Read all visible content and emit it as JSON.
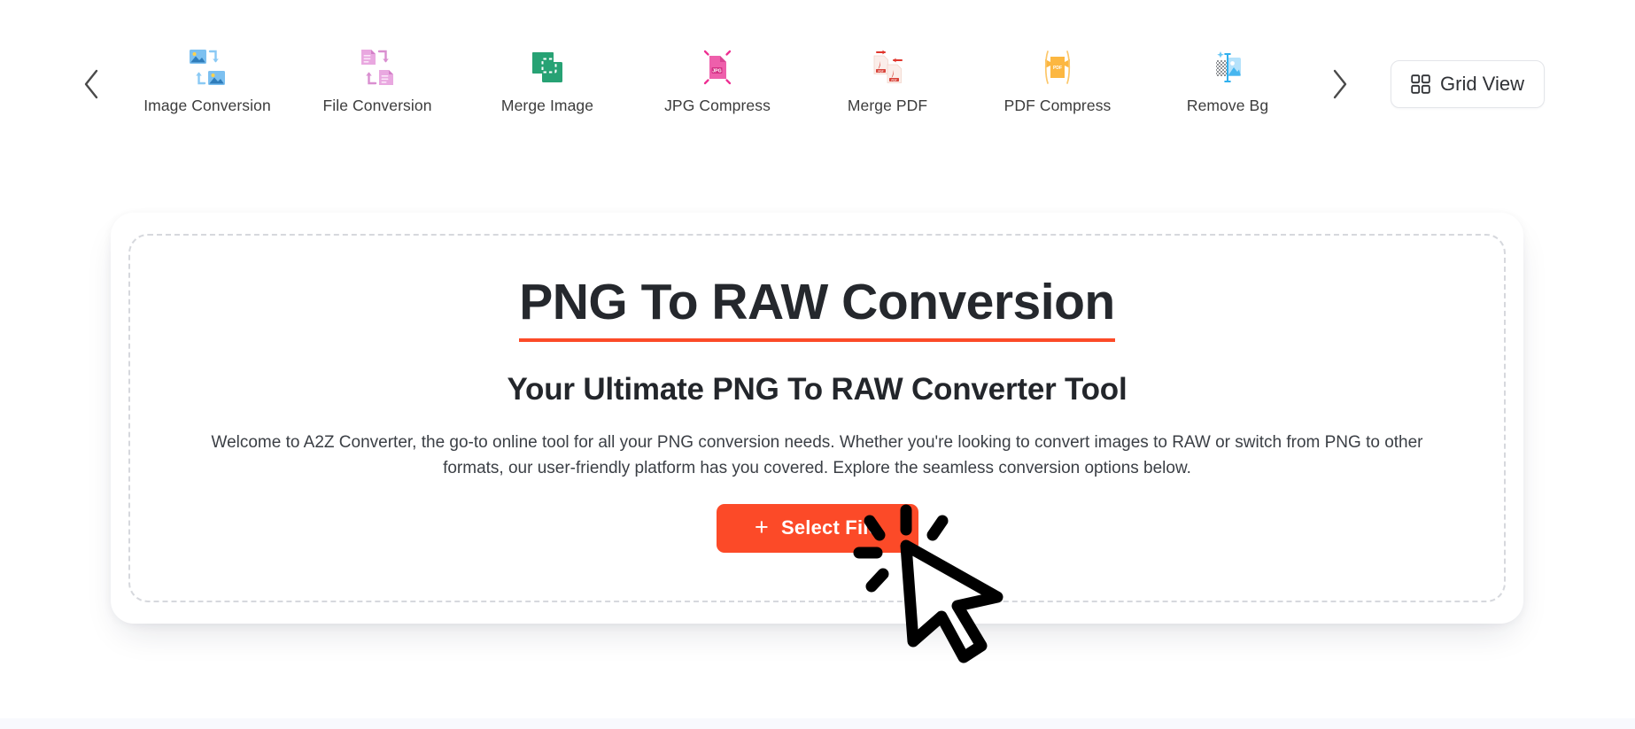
{
  "topbar": {
    "prev_arrow": "chevron-left",
    "next_arrow": "chevron-right",
    "items": [
      {
        "label": "Image Conversion",
        "icon": "image-conversion-icon"
      },
      {
        "label": "File Conversion",
        "icon": "file-conversion-icon"
      },
      {
        "label": "Merge Image",
        "icon": "merge-image-icon"
      },
      {
        "label": "JPG Compress",
        "icon": "jpg-compress-icon"
      },
      {
        "label": "Merge PDF",
        "icon": "merge-pdf-icon"
      },
      {
        "label": "PDF Compress",
        "icon": "pdf-compress-icon"
      },
      {
        "label": "Remove Bg",
        "icon": "remove-bg-icon"
      }
    ],
    "grid_view_label": "Grid View",
    "grid_view_icon": "grid-icon"
  },
  "hero": {
    "title": "PNG To RAW Conversion",
    "subtitle": "Your Ultimate PNG To RAW Converter Tool",
    "description": "Welcome to A2Z Converter, the go-to online tool for all your PNG conversion needs. Whether you're looking to convert images to RAW or switch from PNG to other formats, our user-friendly platform has you covered. Explore the seamless conversion options below.",
    "select_file_label": "Select File",
    "select_file_plus": "+"
  },
  "colors": {
    "accent": "#fc4a28",
    "title_underline": "#fc4a28",
    "text_dark": "#25282d",
    "text_body": "#3b3f45",
    "dropzone_border": "#d6d8dd",
    "page_bg": "#ffffff"
  },
  "cursor": {
    "type": "click-pointer-cursor"
  }
}
